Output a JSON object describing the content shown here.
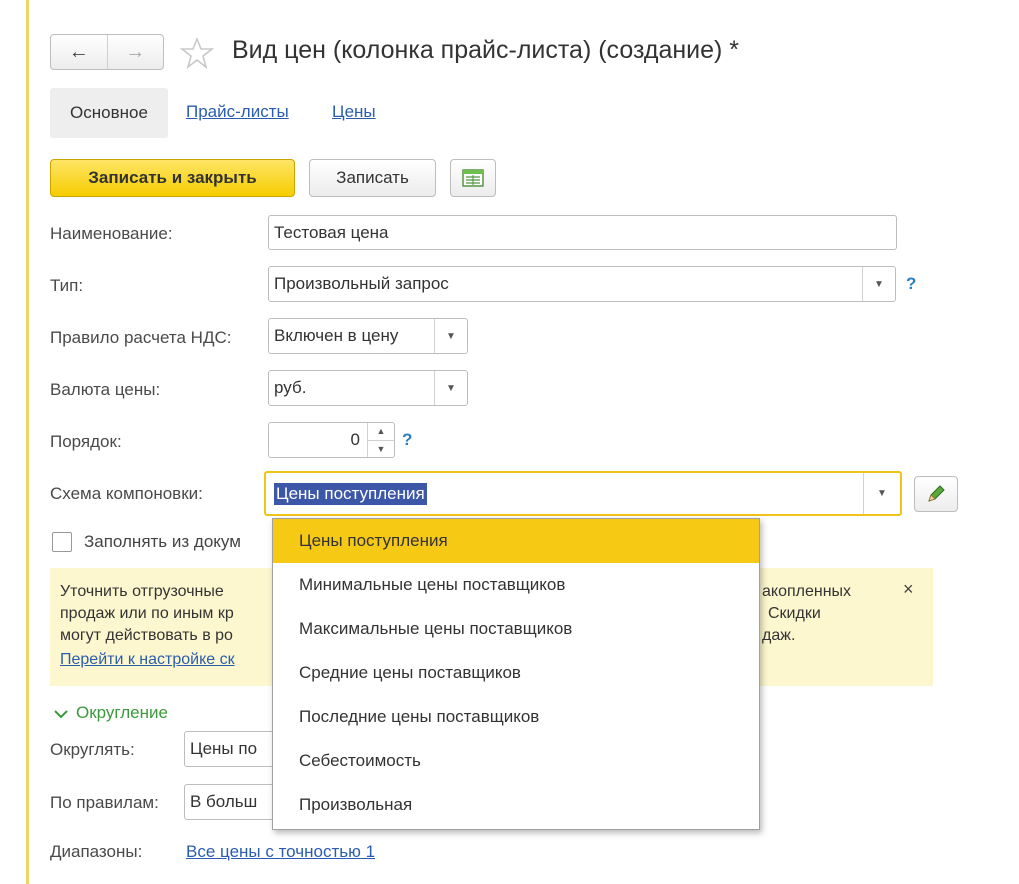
{
  "header": {
    "back_glyph": "←",
    "forward_glyph": "→",
    "title": "Вид цен (колонка прайс-листа) (создание) *"
  },
  "tabs": [
    "Основное",
    "Прайс-листы",
    "Цены"
  ],
  "toolbar": {
    "save_close_label": "Записать и закрыть",
    "save_label": "Записать",
    "report_icon": "spreadsheet-icon"
  },
  "form": {
    "name_label": "Наименование:",
    "name_value": "Тестовая цена",
    "type_label": "Тип:",
    "type_value": "Произвольный запрос",
    "vat_label": "Правило расчета НДС:",
    "vat_value": "Включен в цену",
    "currency_label": "Валюта цены:",
    "currency_value": "руб.",
    "order_label": "Порядок:",
    "order_value": "0",
    "schema_label": "Схема компоновки:",
    "schema_value": "Цены поступления",
    "help_glyph": "?",
    "fill_from_docs_label": "Заполнять из докум",
    "fill_from_docs_checked": false
  },
  "info_message": {
    "line1_left": "Уточнить отгрузочные",
    "line1_right": "акопленных",
    "line2_left": "продаж или по иным кр",
    "line2_right": "Скидки",
    "line3_left": "могут действовать в ро",
    "line3_right": "даж.",
    "link": "Перейти к настройке ск",
    "close_glyph": "×"
  },
  "rounding": {
    "group_title": "Округление",
    "round_label": "Округлять:",
    "round_value": "Цены по",
    "rules_label": "По правилам:",
    "rules_value": "В больш",
    "ranges_label": "Диапазоны:",
    "ranges_link": "Все цены с точностью 1"
  },
  "dropdown": {
    "items": [
      "Цены поступления",
      "Минимальные цены поставщиков",
      "Максимальные цены поставщиков",
      "Средние цены поставщиков",
      "Последние цены поставщиков",
      "Себестоимость",
      "Произвольная"
    ],
    "selected_index": 0
  },
  "colors": {
    "accent_yellow": "#f6c915",
    "link_blue": "#2a5db0",
    "selection_blue": "#3d57a8",
    "group_green": "#3b9a3b",
    "info_bg": "#fdf7cf"
  }
}
